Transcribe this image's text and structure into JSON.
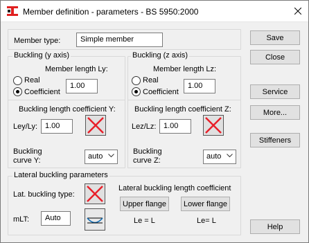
{
  "window": {
    "title": "Member definition - parameters  -  BS 5950:2000"
  },
  "member_type": {
    "label": "Member type:",
    "value": "Simple member"
  },
  "buckling_y": {
    "title": "Buckling (y axis)",
    "length_label": "Member length Ly:",
    "real_label": "Real",
    "coefficient_label": "Coefficient",
    "value": "1.00",
    "selected": "Coefficient",
    "coef_title": "Buckling length coefficient Y:",
    "ratio_label": "Ley/Ly:",
    "ratio_value": "1.00",
    "curve_label_1": "Buckling",
    "curve_label_2": "curve   Y:",
    "curve_value": "auto"
  },
  "buckling_z": {
    "title": "Buckling (z axis)",
    "length_label": "Member length Lz:",
    "real_label": "Real",
    "coefficient_label": "Coefficient",
    "value": "1.00",
    "selected": "Coefficient",
    "coef_title": "Buckling length coefficient Z:",
    "ratio_label": "Lez/Lz:",
    "ratio_value": "1.00",
    "curve_label_1": "Buckling",
    "curve_label_2": "curve   Z:",
    "curve_value": "auto"
  },
  "lateral": {
    "title": "Lateral buckling parameters",
    "type_label": "Lat. buckling type:",
    "mlt_label": "mLT:",
    "mlt_value": "Auto",
    "coef_title": "Lateral buckling length coefficient",
    "upper_flange": "Upper flange",
    "lower_flange": "Lower flange",
    "le_upper": "Le = L",
    "le_lower": "Le=  L"
  },
  "buttons": {
    "save": "Save",
    "close": "Close",
    "service": "Service",
    "more": "More...",
    "stiffeners": "Stiffeners",
    "help": "Help"
  },
  "colors": {
    "cross": "#e8202a",
    "accent": "#0a6ab5"
  }
}
